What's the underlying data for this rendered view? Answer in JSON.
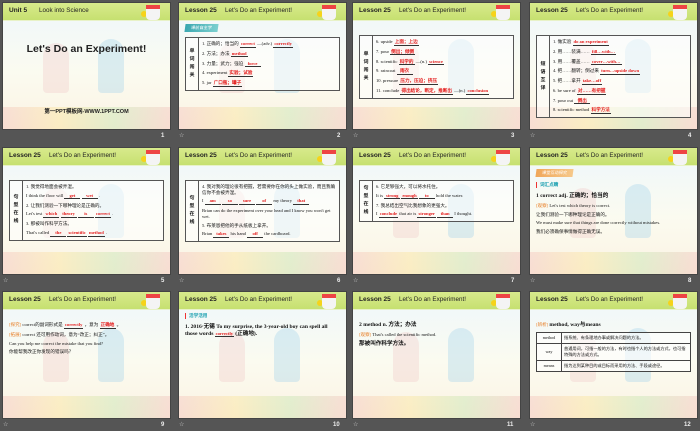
{
  "slides": [
    {
      "number": "1",
      "kind": "title",
      "header": {
        "label": "Unit 5",
        "title": "Look into Science"
      },
      "title": "Let's Do an Experiment!",
      "footer": "第一PPT模板网-WWW.1PPT.COM"
    },
    {
      "number": "2",
      "header": {
        "label": "Lesson 25",
        "title": "Let's Do an Experiment!"
      },
      "tag": "课前自主学",
      "table_label": [
        "单",
        "词",
        "闯",
        "关"
      ],
      "lines": [
        [
          {
            "t": "1. 正确的；恰当的"
          },
          {
            "a": "correct"
          },
          {
            "t": "—(adv.)"
          },
          {
            "a": "correctly"
          }
        ],
        [
          {
            "t": "2. 方法；办法"
          },
          {
            "a": "method"
          }
        ],
        [
          {
            "t": "3. 力量；武力；强迫"
          },
          {
            "a": "force"
          }
        ],
        [
          {
            "t": "4. experiment"
          },
          {
            "a": "实验；试验"
          }
        ],
        [
          {
            "t": "5. jar"
          },
          {
            "a": "广口瓶；罐子"
          }
        ]
      ]
    },
    {
      "number": "3",
      "header": {
        "label": "Lesson 25",
        "title": "Let's Do an Experiment!"
      },
      "table_label": [
        "单",
        "词",
        "闯",
        "关"
      ],
      "lines": [
        [
          {
            "t": "6. upside"
          },
          {
            "a": "上面；上边"
          }
        ],
        [
          {
            "t": "7. pour"
          },
          {
            "a": "倒出；倾倒"
          }
        ],
        [
          {
            "t": "8. scientific"
          },
          {
            "a": "科学的"
          },
          {
            "t": "—(n.)"
          },
          {
            "a": "science"
          }
        ],
        [
          {
            "t": "9. raincoat"
          },
          {
            "a": "雨衣"
          }
        ],
        [
          {
            "t": "10. pressure"
          },
          {
            "a": "压力，压迫；挤压"
          }
        ],
        [
          {
            "t": "11. conclude"
          },
          {
            "a": "得出结论，断定，推断出"
          },
          {
            "t": "—(n.)"
          },
          {
            "a": "conclusion"
          }
        ]
      ]
    },
    {
      "number": "4",
      "header": {
        "label": "Lesson 25",
        "title": "Let's Do an Experiment!"
      },
      "table_label": [
        "短",
        "语",
        "互",
        "译"
      ],
      "lines": [
        [
          {
            "t": "1. 做实验"
          },
          {
            "a": "do an experiment"
          }
        ],
        [
          {
            "t": "2. 用……装满……"
          },
          {
            "a": "fill…with…"
          }
        ],
        [
          {
            "t": "3. 用……覆盖……"
          },
          {
            "a": "cover…with…"
          }
        ],
        [
          {
            "t": "4. 把……翻转；倒过来"
          },
          {
            "a": "turn…upside down"
          }
        ],
        [
          {
            "t": "5. 把……拿开"
          },
          {
            "a": "take…off"
          }
        ],
        [
          {
            "t": "6. be sure of"
          },
          {
            "a": "对……有把握"
          }
        ],
        [
          {
            "t": "7. pour out"
          },
          {
            "a": "倒出"
          }
        ],
        [
          {
            "t": "8. scientific method"
          },
          {
            "a": "科学方法"
          }
        ]
      ]
    },
    {
      "number": "5",
      "header": {
        "label": "Lesson 25",
        "title": "Let's Do an Experiment!"
      },
      "table_label": [
        "句",
        "型",
        "在",
        "线"
      ],
      "lines": [
        [
          {
            "t": "1. 我觉得地面会被弄湿。"
          }
        ],
        [
          {
            "t": "I think the floor will"
          },
          {
            "a": "get"
          },
          {
            "a": "wet"
          },
          {
            "t": "."
          }
        ],
        [
          {
            "t": "2. 让我们测验一下哪种理论是正确的。"
          }
        ],
        [
          {
            "t": "Let's test"
          },
          {
            "a": "which"
          },
          {
            "a": "theory"
          },
          {
            "a": "is"
          },
          {
            "a": "correct"
          },
          {
            "t": "."
          }
        ],
        [
          {
            "t": "3. 那被叫作科学方法。"
          }
        ],
        [
          {
            "t": "That's called"
          },
          {
            "a": "the"
          },
          {
            "a": "scientific"
          },
          {
            "a": "method"
          },
          {
            "t": "."
          }
        ]
      ]
    },
    {
      "number": "6",
      "header": {
        "label": "Lesson 25",
        "title": "Let's Do an Experiment!"
      },
      "table_label": [
        "句",
        "型",
        "在",
        "线"
      ],
      "lines": [
        [
          {
            "t": "4. 我对我的理论很有把握，若需要你在你的头上做实验，而且我确信你不会被弄湿。"
          }
        ],
        [
          {
            "t": "I"
          },
          {
            "a": "am"
          },
          {
            "a": "so"
          },
          {
            "a": "sure"
          },
          {
            "a": "of"
          },
          {
            "t": "my theory"
          },
          {
            "a": "that"
          }
        ],
        [
          {
            "t": "Brian can do the experiment over your head and I know you won't get wet."
          }
        ],
        [
          {
            "t": "5. 布莱恩把他的手从纸板上拿开。"
          }
        ],
        [
          {
            "t": "Brian"
          },
          {
            "a": "takes"
          },
          {
            "t": "his hand"
          },
          {
            "a": "off"
          },
          {
            "t": "the cardboard."
          }
        ]
      ]
    },
    {
      "number": "7",
      "header": {
        "label": "Lesson 25",
        "title": "Let's Do an Experiment!"
      },
      "table_label": [
        "句",
        "型",
        "在",
        "线"
      ],
      "lines": [
        [
          {
            "t": "6. 它足够强大，可以将水托住。"
          }
        ],
        [
          {
            "t": "It is"
          },
          {
            "a": "strong"
          },
          {
            "a": "enough"
          },
          {
            "a": "to"
          },
          {
            "t": "hold the water."
          }
        ],
        [
          {
            "t": "7. 我总结出空气比我想象的更强大。"
          }
        ],
        [
          {
            "t": "I"
          },
          {
            "a": "conclude"
          },
          {
            "t": "that air is"
          },
          {
            "a": "stronger"
          },
          {
            "a": "than"
          },
          {
            "t": "I thought."
          }
        ]
      ]
    },
    {
      "number": "8",
      "header": {
        "label": "Lesson 25",
        "title": "Let's Do an Experiment!"
      },
      "tag": "课堂互动探究",
      "tag_style": "orange",
      "subhead": "词汇点睛",
      "lines": [
        [
          {
            "b": "1   correct adj. 正确的；恰当的"
          }
        ],
        [
          {
            "k": "[观察]"
          },
          {
            "t": " Let's test which theory is correct."
          }
        ],
        [
          {
            "t": "让我们测验一下哪种理论是正确的。"
          }
        ],
        [
          {
            "t": "We must make sure that things are done correctly without mistakes."
          }
        ],
        [
          {
            "t": "我们必须确保事情做得正确无误。"
          }
        ]
      ]
    },
    {
      "number": "9",
      "header": {
        "label": "Lesson 25",
        "title": "Let's Do an Experiment!"
      },
      "lines": [
        [
          {
            "k": "[探究]"
          },
          {
            "t": " correct的副词形式是"
          },
          {
            "a": "correctly"
          },
          {
            "t": "，意为"
          },
          {
            "a": "正确地"
          },
          {
            "t": "。"
          }
        ],
        [
          {
            "k": "[拓展]"
          },
          {
            "t": " correct 还可用作动词，意为“改正；纠正”。"
          }
        ],
        [
          {
            "t": "Can you help me correct the mistake that you find?"
          }
        ],
        [
          {
            "t": "你能帮我改正你发现的错误吗？"
          }
        ]
      ]
    },
    {
      "number": "10",
      "header": {
        "label": "Lesson 25",
        "title": "Let's Do an Experiment!"
      },
      "subhead": "活学活用",
      "lines": [
        [
          {
            "b": "1. 2016·无锡 To my surprise, the 3-year-old boy can spell all those words"
          },
          {
            "a": "correctly"
          },
          {
            "b": "(正确地)."
          }
        ]
      ]
    },
    {
      "number": "11",
      "header": {
        "label": "Lesson 25",
        "title": "Let's Do an Experiment!"
      },
      "lines": [
        [
          {
            "b": "2   method n. 方法；办法"
          }
        ],
        [
          {
            "k": "[观察]"
          },
          {
            "t": " That's called the scientific method."
          }
        ],
        [
          {
            "b": "那被叫作科学方法。"
          }
        ]
      ]
    },
    {
      "number": "12",
      "header": {
        "label": "Lesson 25",
        "title": "Let's Do an Experiment!"
      },
      "lines": [
        [
          {
            "k": "[辨析]"
          },
          {
            "b": " method, way与means"
          }
        ]
      ],
      "compare": [
        {
          "k": "method",
          "v": "指系统、有条理地办事或解决问题的方法。"
        },
        {
          "k": "way",
          "v": "普通用词，可指一般的方法，有时也指个人的方法或方式，也可指特殊的方法或方式。"
        },
        {
          "k": "means",
          "v": "指为达到某种目的或目标而采用的方法、手段或途径。"
        }
      ]
    }
  ],
  "colors": {
    "header": "#c6e070",
    "answer": "#e41b1b",
    "background": "#555555"
  }
}
